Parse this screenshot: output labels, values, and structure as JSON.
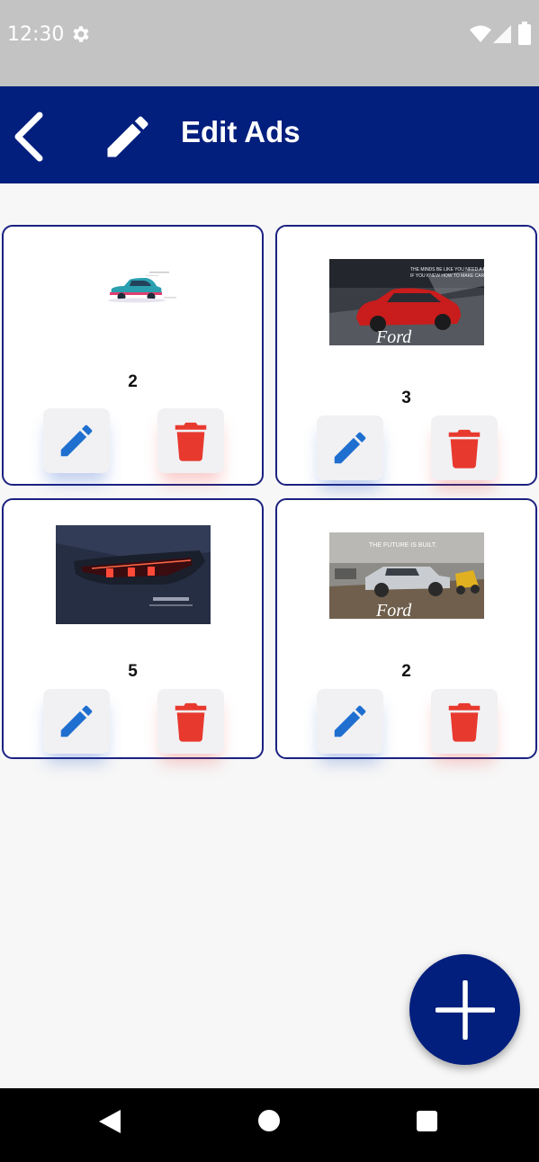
{
  "status_bar": {
    "time": "12:30",
    "icons": [
      "gear-icon",
      "wifi-icon",
      "signal-icon",
      "battery-icon"
    ]
  },
  "app_bar": {
    "title": "Edit Ads",
    "back_icon": "chevron-left-icon",
    "title_icon": "pencil-icon",
    "background": "#021f7e"
  },
  "ads": [
    {
      "count": "2",
      "image": "teal compact car illustration"
    },
    {
      "count": "3",
      "image": "red Ford Mustang ad",
      "image_text": [
        "THE MINDS BE LIKE YOU NEED A ROAD IF YOU KNEW HOW TO MAKE CARS.",
        "Ford"
      ]
    },
    {
      "count": "5",
      "image": "dark SUV tail light close-up"
    },
    {
      "count": "2",
      "image": "Ford pickup truck ad",
      "image_text": [
        "THE FUTURE IS BUILT.",
        "Ford"
      ]
    }
  ],
  "actions": {
    "edit_icon": "pencil-icon",
    "delete_icon": "trash-icon",
    "edit_color": "#1f6fd0",
    "delete_color": "#e8392f"
  },
  "fab": {
    "icon": "plus-icon"
  },
  "nav_bar": {
    "icons": [
      "nav-back-icon",
      "nav-home-icon",
      "nav-recents-icon"
    ]
  }
}
